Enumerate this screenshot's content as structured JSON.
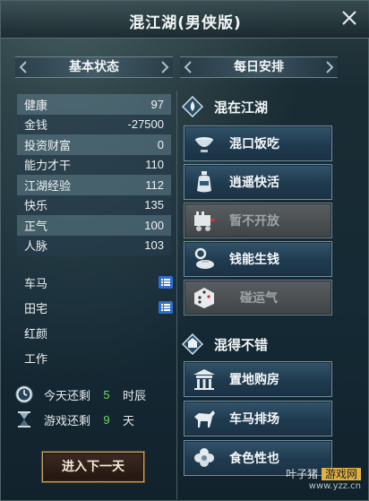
{
  "window": {
    "title": "混江湖(男侠版)",
    "close_label": "✕"
  },
  "left": {
    "header": "基本状态",
    "stats": [
      {
        "label": "健康",
        "value": "97"
      },
      {
        "label": "金钱",
        "value": "-27500"
      },
      {
        "label": "投资财富",
        "value": "0"
      },
      {
        "label": "能力才干",
        "value": "110"
      },
      {
        "label": "江湖经验",
        "value": "112"
      },
      {
        "label": "快乐",
        "value": "135"
      },
      {
        "label": "正气",
        "value": "100"
      },
      {
        "label": "人脉",
        "value": "103"
      }
    ],
    "props": [
      {
        "label": "车马",
        "has_list": true
      },
      {
        "label": "田宅",
        "has_list": true
      },
      {
        "label": "红颜",
        "has_list": false
      },
      {
        "label": "工作",
        "has_list": false
      }
    ],
    "today": {
      "prefix": "今天还剩",
      "value": "5",
      "unit": "时辰"
    },
    "game": {
      "prefix": "游戏还剩",
      "value": "9",
      "unit": "天"
    },
    "next_button": "进入下一天"
  },
  "right": {
    "header": "每日安排",
    "group1": {
      "title": "混在江湖",
      "buttons": [
        {
          "label": "混口饭吃",
          "icon": "bowl-icon",
          "disabled": false
        },
        {
          "label": "逍遥快活",
          "icon": "wine-icon",
          "disabled": false
        },
        {
          "label": "暂不开放",
          "icon": "cart-icon",
          "disabled": true
        },
        {
          "label": "钱能生钱",
          "icon": "money-icon",
          "disabled": false
        },
        {
          "label": "碰运气",
          "icon": "dice-icon",
          "disabled": true
        }
      ]
    },
    "group2": {
      "title": "混得不错",
      "buttons": [
        {
          "label": "置地购房",
          "icon": "house-icon",
          "disabled": false
        },
        {
          "label": "车马排场",
          "icon": "horse-icon",
          "disabled": false
        },
        {
          "label": "食色性也",
          "icon": "flower-icon",
          "disabled": false
        }
      ]
    }
  },
  "watermark": {
    "brand": "叶子猪",
    "tag": "游戏网",
    "url": "www.yzz.cn"
  },
  "colors": {
    "accent_green": "#6ddb57",
    "button_border": "#6f8fa4",
    "next_border": "#c5a46b"
  }
}
